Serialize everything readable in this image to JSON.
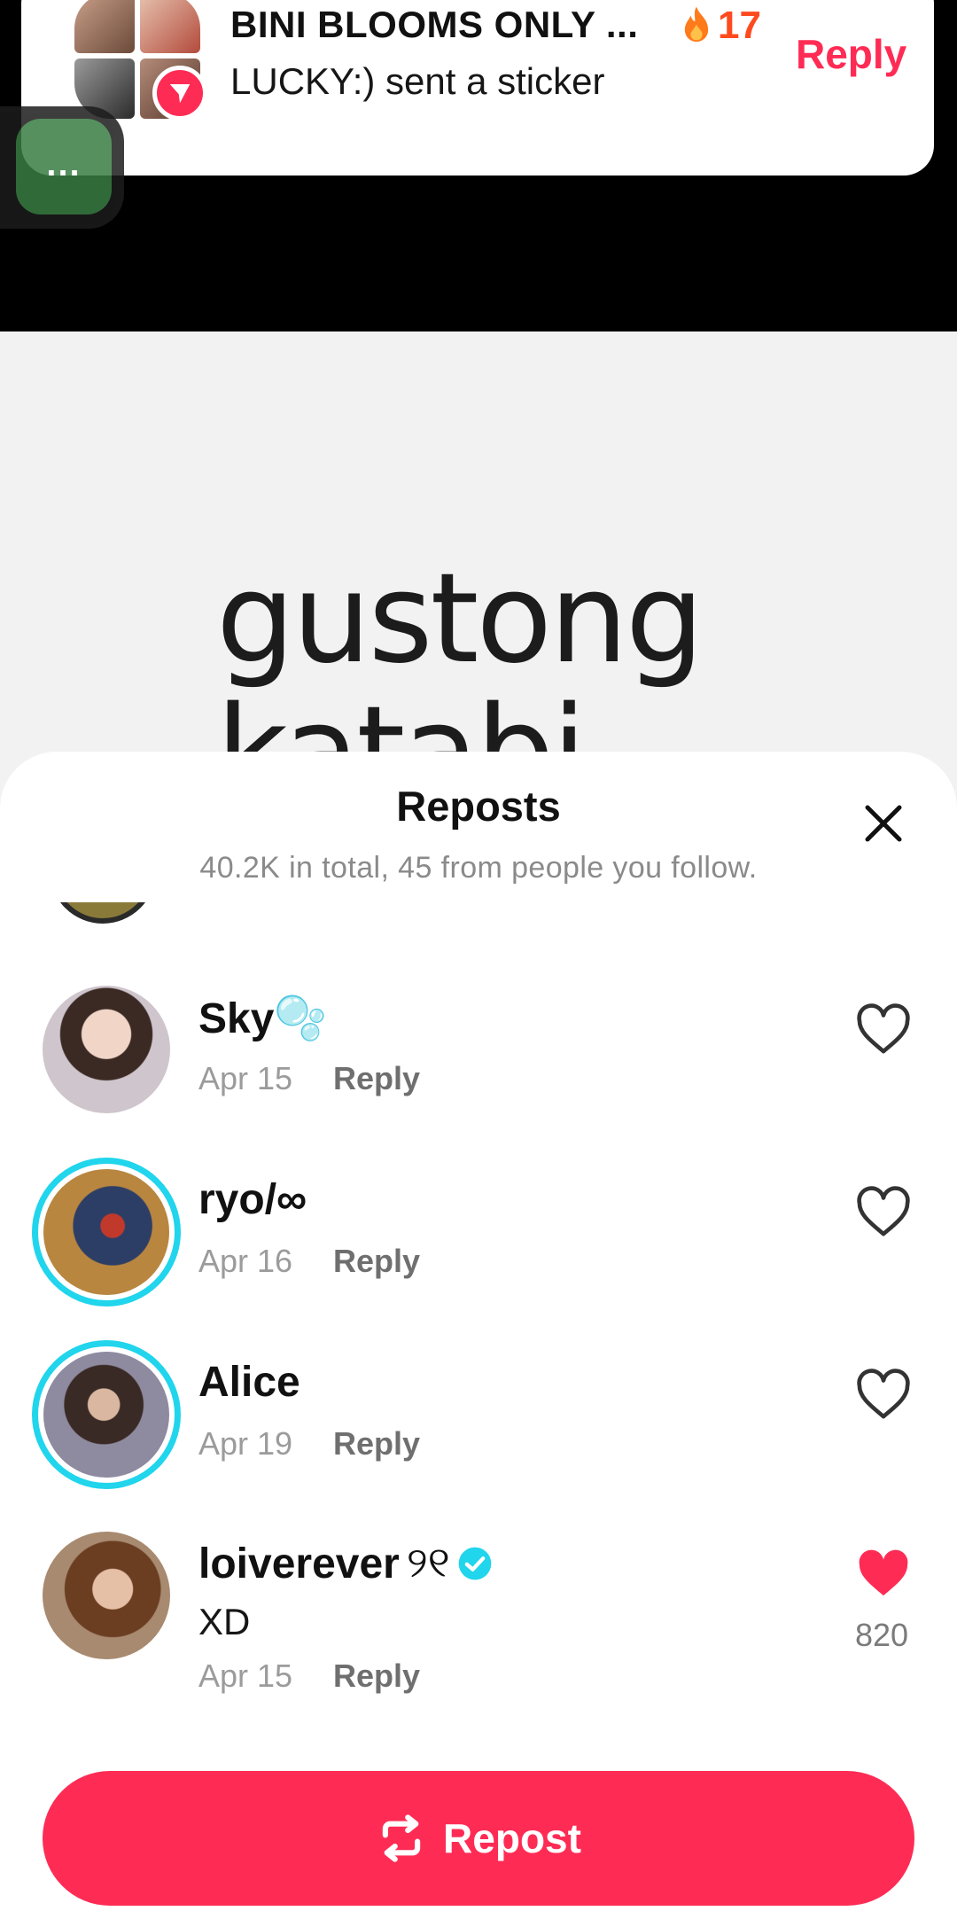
{
  "notification": {
    "group_name": "BINI BLOOMS ONLY ...",
    "streak_count": "17",
    "message": "LUCKY:) sent a sticker",
    "reply_label": "Reply",
    "streak_icon": "fire-icon"
  },
  "video": {
    "caption_lines": [
      "gustong",
      "katabi"
    ]
  },
  "sheet": {
    "title": "Reposts",
    "subtitle": "40.2K in total, 45 from people you follow.",
    "items": [
      {
        "name": "Sky🫧",
        "date": "Apr 15",
        "reply": "Reply",
        "liked": false
      },
      {
        "name": "ryo/∞",
        "date": "Apr 16",
        "reply": "Reply",
        "liked": false
      },
      {
        "name": "Alice",
        "date": "Apr 19",
        "reply": "Reply",
        "liked": false
      },
      {
        "name": "loiverever",
        "name_suffix": "୨୧",
        "verified": true,
        "comment": "XD",
        "date": "Apr 15",
        "reply": "Reply",
        "liked": true,
        "likes": "820"
      }
    ],
    "repost_button": "Repost"
  },
  "colors": {
    "accent": "#fe2c55",
    "ring": "#20d5ec",
    "verified": "#20d5ec"
  }
}
